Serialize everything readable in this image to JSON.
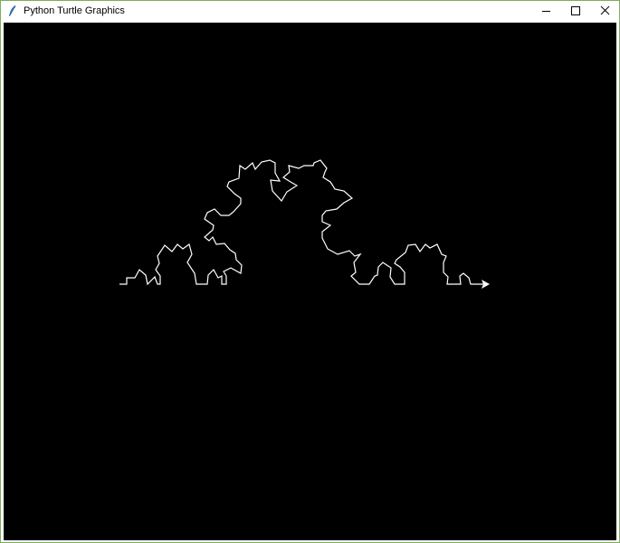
{
  "window": {
    "title": "Python Turtle Graphics",
    "app_icon": "feather-icon",
    "controls": {
      "minimize_icon": "minimize-icon",
      "maximize_icon": "maximize-icon",
      "close_icon": "close-icon"
    }
  },
  "canvas": {
    "background": "#000000",
    "pen_color": "#ffffff",
    "turtle_shape": "arrow-icon",
    "drawing": "fractal-curve"
  },
  "colors": {
    "window_border": "#7fae5a",
    "titlebar": "#ffffff",
    "title_text": "#000000"
  }
}
